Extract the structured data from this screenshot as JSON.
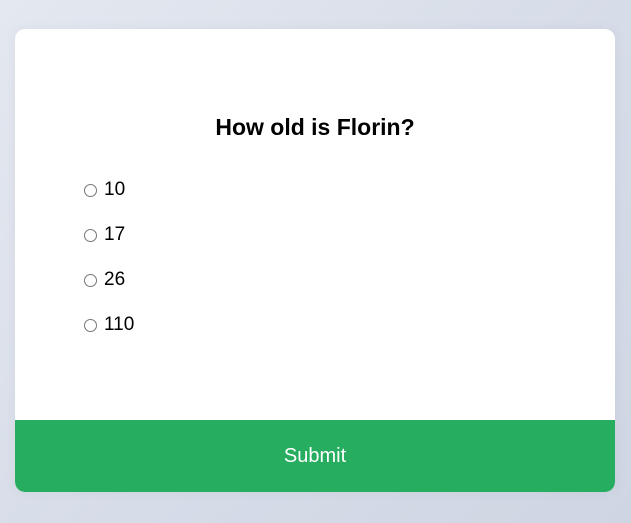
{
  "quiz": {
    "question": "How old is Florin?",
    "answers": [
      {
        "label": "10",
        "selected": false
      },
      {
        "label": "17",
        "selected": false
      },
      {
        "label": "26",
        "selected": false
      },
      {
        "label": "110",
        "selected": false
      }
    ],
    "submit_label": "Submit"
  },
  "colors": {
    "submit_background": "#26ad60",
    "card_background": "#ffffff",
    "page_background": "#dbe0ea"
  }
}
